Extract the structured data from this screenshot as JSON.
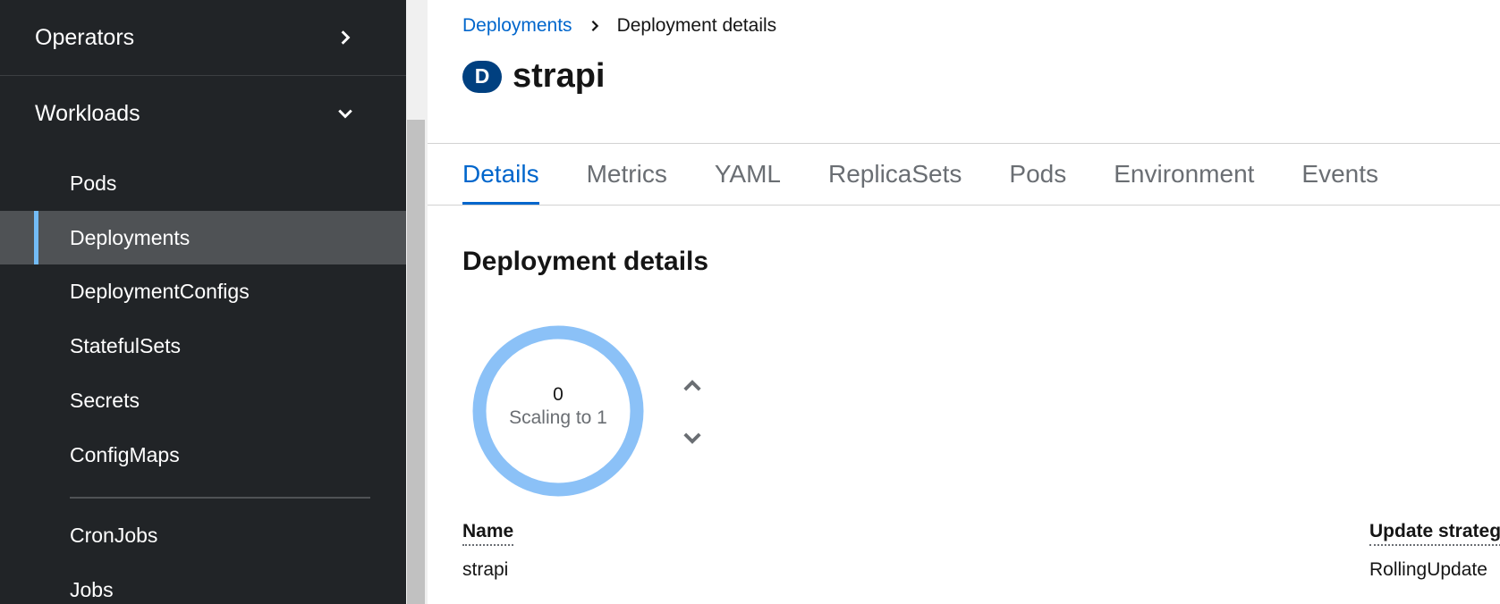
{
  "sidebar": {
    "groups": [
      {
        "label": "Operators",
        "icon": "chevron-right-icon"
      },
      {
        "label": "Workloads",
        "icon": "chevron-down-icon"
      }
    ],
    "items": [
      {
        "label": "Pods"
      },
      {
        "label": "Deployments",
        "active": true
      },
      {
        "label": "DeploymentConfigs"
      },
      {
        "label": "StatefulSets"
      },
      {
        "label": "Secrets"
      },
      {
        "label": "ConfigMaps"
      },
      {
        "label": "CronJobs"
      },
      {
        "label": "Jobs"
      }
    ]
  },
  "breadcrumb": {
    "parent": "Deployments",
    "current": "Deployment details"
  },
  "header": {
    "badge": "D",
    "title": "strapi"
  },
  "tabs": [
    {
      "label": "Details",
      "active": true
    },
    {
      "label": "Metrics"
    },
    {
      "label": "YAML"
    },
    {
      "label": "ReplicaSets"
    },
    {
      "label": "Pods"
    },
    {
      "label": "Environment"
    },
    {
      "label": "Events"
    }
  ],
  "details": {
    "section_title": "Deployment details",
    "pod_ring": {
      "count": "0",
      "status": "Scaling to 1",
      "ring_color": "#8bc1f7"
    },
    "name_label": "Name",
    "name_value": "strapi",
    "strategy_label": "Update strategy",
    "strategy_value": "RollingUpdate"
  },
  "colors": {
    "sidebar_bg": "#212427",
    "active_item_bg": "#4f5255",
    "active_indicator": "#73bcf7",
    "link": "#0066cc",
    "badge_bg": "#004080"
  }
}
